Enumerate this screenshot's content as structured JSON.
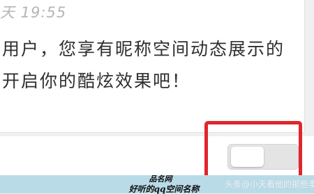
{
  "message": {
    "timestamp": "天 19:55",
    "line1": "用户，您享有昵称空间动态展示的",
    "line2": "开启你的酷炫效果吧！"
  },
  "setting": {
    "toggle_on": false
  },
  "caption": {
    "site": "品名网",
    "title": "好听的qq空间名称"
  },
  "watermark": "头条@小天看他的那些事",
  "colors": {
    "highlight": "#e0262c",
    "caption_band": "#b9dbe8",
    "toggle_track": "#e4e4e4"
  }
}
